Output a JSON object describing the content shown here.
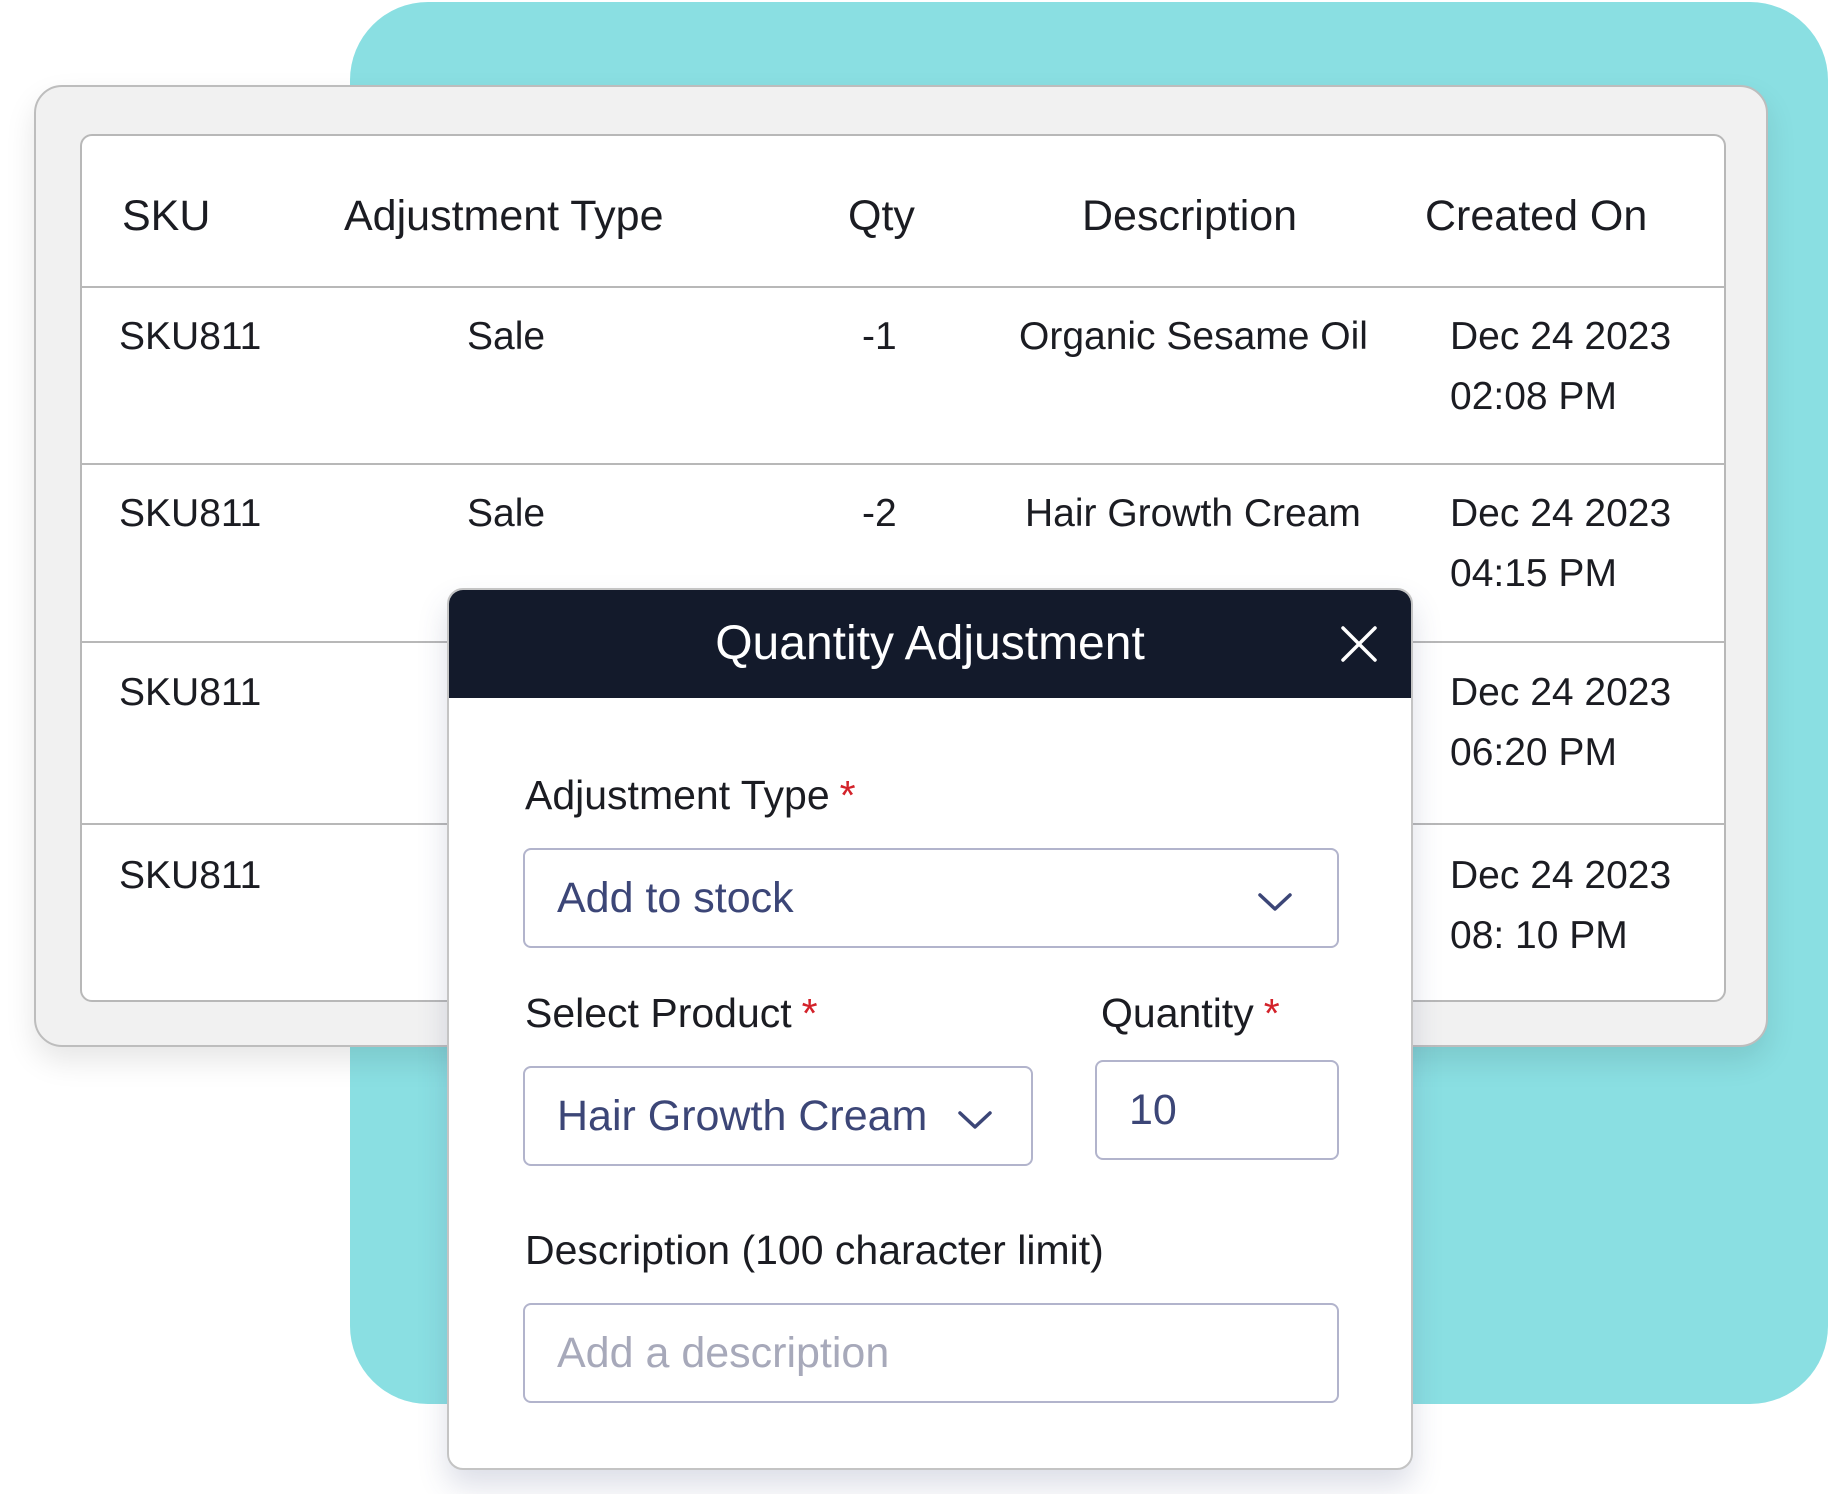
{
  "table": {
    "columns": [
      "SKU",
      "Adjustment Type",
      "Qty",
      "Description",
      "Created On"
    ],
    "rows": [
      {
        "sku": "SKU811",
        "type": "Sale",
        "qty": "-1",
        "description": "Organic Sesame Oil",
        "created_on": "Dec 24 2023 02:08 PM"
      },
      {
        "sku": "SKU811",
        "type": "Sale",
        "qty": "-2",
        "description": "Hair Growth Cream",
        "created_on": "Dec 24 2023 04:15 PM"
      },
      {
        "sku": "SKU811",
        "type": "",
        "qty": "",
        "description": "",
        "created_on": "Dec 24 2023 06:20 PM"
      },
      {
        "sku": "SKU811",
        "type": "",
        "qty": "",
        "description": "",
        "created_on": "Dec 24 2023 08: 10 PM"
      }
    ]
  },
  "modal": {
    "title": "Quantity Adjustment",
    "close_icon": "close-icon",
    "adjustment_type": {
      "label": "Adjustment Type",
      "required_mark": "*",
      "value": "Add to stock"
    },
    "product": {
      "label": "Select Product",
      "required_mark": "*",
      "value": "Hair Growth Cream"
    },
    "quantity": {
      "label": "Quantity",
      "required_mark": "*",
      "value": "10"
    },
    "description": {
      "label": "Description (100 character limit)",
      "placeholder": "Add a description"
    }
  },
  "colors": {
    "teal_background": "#8adfe2",
    "modal_header": "#131a2b",
    "required": "#d3222a",
    "field_text": "#3c4677"
  }
}
